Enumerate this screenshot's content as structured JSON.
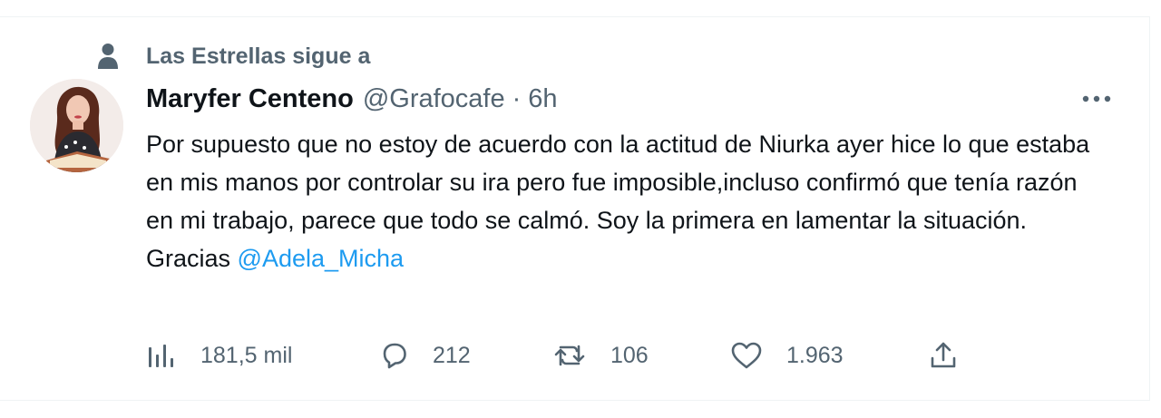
{
  "social_context": {
    "icon": "person-icon",
    "text": "Las Estrellas sigue a"
  },
  "author": {
    "name": "Maryfer Centeno",
    "handle": "@Grafocafe",
    "separator": "·",
    "time": "6h"
  },
  "tweet": {
    "text": "Por supuesto que no estoy de acuerdo con la actitud de Niurka ayer hice lo que estaba en mis manos por controlar su ira pero fue imposible,incluso confirmó que tenía razón en mi trabajo, parece que todo se calmó. Soy la primera en lamentar la situación.",
    "closing_text": "Gracias ",
    "mention": "@Adela_Micha"
  },
  "actions": {
    "views": {
      "icon": "views-chart-icon",
      "count": "181,5 mil"
    },
    "replies": {
      "icon": "reply-bubble-icon",
      "count": "212"
    },
    "retweets": {
      "icon": "retweet-icon",
      "count": "106"
    },
    "likes": {
      "icon": "heart-icon",
      "count": "1.963"
    },
    "share": {
      "icon": "share-upload-icon"
    }
  },
  "colors": {
    "text_primary": "#0f1419",
    "text_secondary": "#536471",
    "accent": "#1d9bf0",
    "border": "#eff3f4"
  }
}
